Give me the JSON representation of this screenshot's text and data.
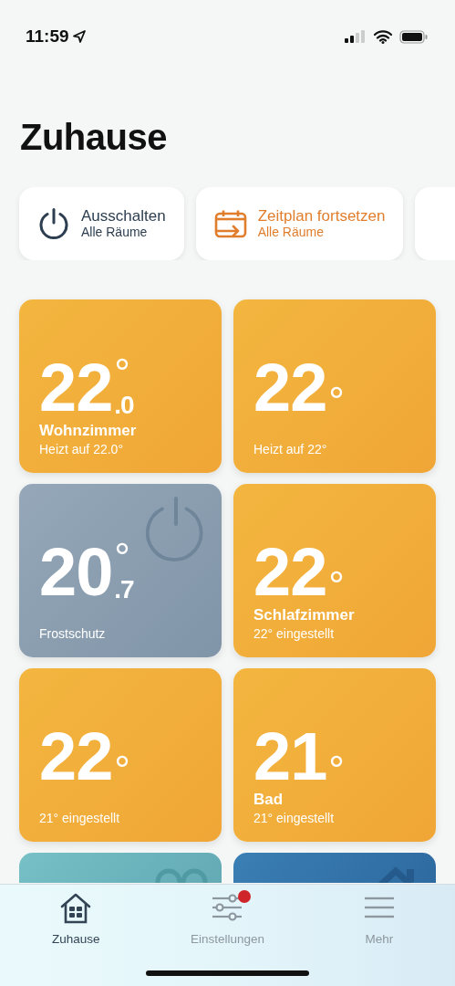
{
  "status_bar": {
    "time": "11:59"
  },
  "title": "Zuhause",
  "actions": [
    {
      "kind": "power",
      "label": "Ausschalten",
      "sublabel": "Alle Räume"
    },
    {
      "kind": "schedule",
      "label": "Zeitplan fortsetzen",
      "sublabel": "Alle Räume"
    },
    {
      "kind": "clipped"
    }
  ],
  "rooms": [
    {
      "kind": "heating",
      "temperature": "22",
      "decimal": ".0",
      "unit": "°",
      "name": "Wohnzimmer",
      "status": "Heizt auf 22.0°"
    },
    {
      "kind": "heating",
      "temperature": "22",
      "unit": "°",
      "status": "Heizt auf 22°"
    },
    {
      "kind": "off",
      "temperature": "20",
      "decimal": ".7",
      "unit": "°",
      "status": "Frostschutz"
    },
    {
      "kind": "heating",
      "temperature": "22",
      "unit": "°",
      "name": "Schlafzimmer",
      "status": "22° eingestellt"
    },
    {
      "kind": "heating",
      "temperature": "22",
      "unit": "°",
      "status": "21° eingestellt"
    },
    {
      "kind": "heating",
      "temperature": "21",
      "unit": "°",
      "name": "Bad",
      "status": "21° eingestellt"
    },
    {
      "kind": "away"
    },
    {
      "kind": "home"
    }
  ],
  "tab_bar": [
    {
      "kind": "home",
      "label": "Zuhause",
      "selected": true,
      "badge": false
    },
    {
      "kind": "settings",
      "label": "Einstellungen",
      "selected": false,
      "badge": true
    },
    {
      "kind": "menu",
      "label": "Mehr",
      "selected": false,
      "badge": false
    }
  ]
}
